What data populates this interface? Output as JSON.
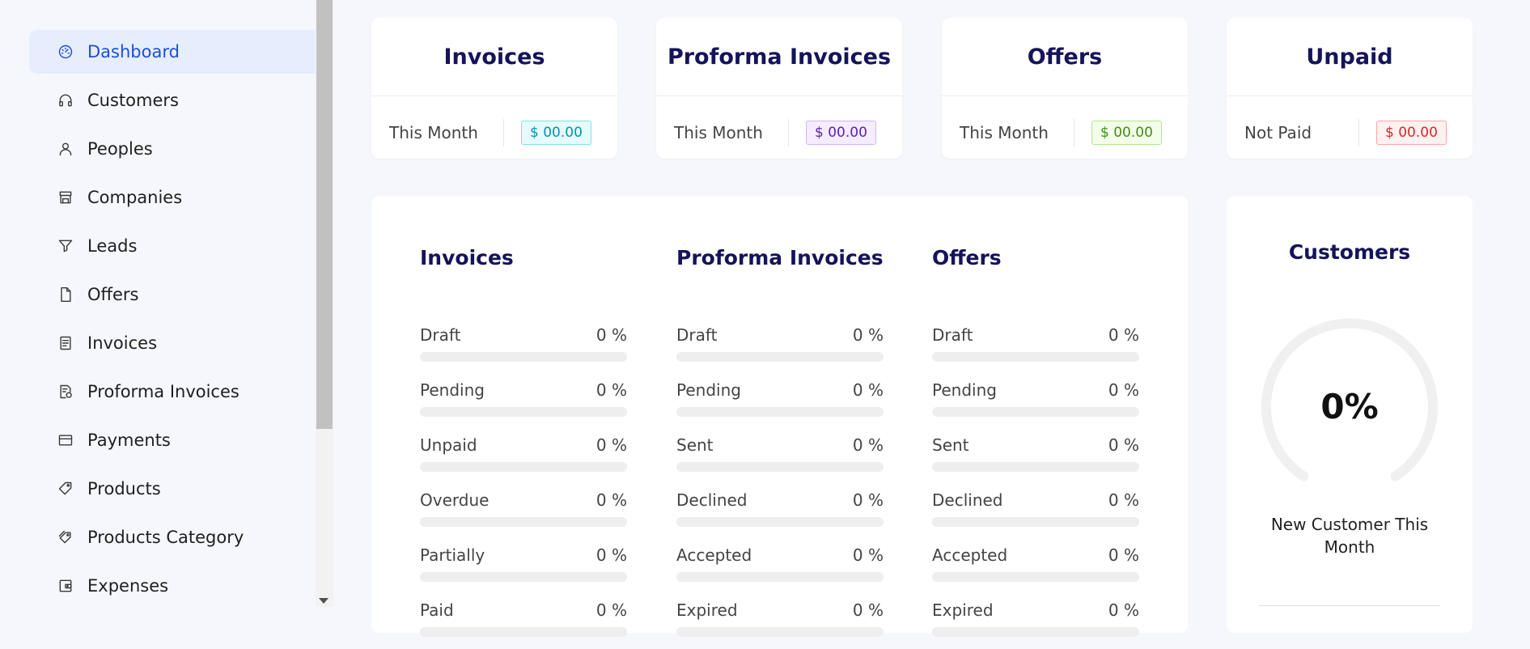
{
  "sidebar": {
    "items": [
      {
        "label": "Dashboard",
        "icon": "dashboard-icon",
        "active": true
      },
      {
        "label": "Customers",
        "icon": "headset-icon"
      },
      {
        "label": "Peoples",
        "icon": "user-icon"
      },
      {
        "label": "Companies",
        "icon": "shop-icon"
      },
      {
        "label": "Leads",
        "icon": "filter-icon"
      },
      {
        "label": "Offers",
        "icon": "file-icon"
      },
      {
        "label": "Invoices",
        "icon": "container-icon"
      },
      {
        "label": "Proforma Invoices",
        "icon": "file-sync-icon"
      },
      {
        "label": "Payments",
        "icon": "credit-card-icon"
      },
      {
        "label": "Products",
        "icon": "tag-icon"
      },
      {
        "label": "Products Category",
        "icon": "tags-icon"
      },
      {
        "label": "Expenses",
        "icon": "wallet-icon"
      }
    ]
  },
  "stats": [
    {
      "title": "Invoices",
      "sub": "This Month",
      "value": "$ 00.00",
      "color": "cyan"
    },
    {
      "title": "Proforma Invoices",
      "sub": "This Month",
      "value": "$ 00.00",
      "color": "purple"
    },
    {
      "title": "Offers",
      "sub": "This Month",
      "value": "$ 00.00",
      "color": "green"
    },
    {
      "title": "Unpaid",
      "sub": "Not Paid",
      "value": "$ 00.00",
      "color": "red"
    }
  ],
  "panel": {
    "columns": [
      {
        "title": "Invoices",
        "rows": [
          {
            "label": "Draft",
            "value": "0 %",
            "percent": 0
          },
          {
            "label": "Pending",
            "value": "0 %",
            "percent": 0
          },
          {
            "label": "Unpaid",
            "value": "0 %",
            "percent": 0
          },
          {
            "label": "Overdue",
            "value": "0 %",
            "percent": 0
          },
          {
            "label": "Partially",
            "value": "0 %",
            "percent": 0
          },
          {
            "label": "Paid",
            "value": "0 %",
            "percent": 0
          }
        ]
      },
      {
        "title": "Proforma Invoices",
        "rows": [
          {
            "label": "Draft",
            "value": "0 %",
            "percent": 0
          },
          {
            "label": "Pending",
            "value": "0 %",
            "percent": 0
          },
          {
            "label": "Sent",
            "value": "0 %",
            "percent": 0
          },
          {
            "label": "Declined",
            "value": "0 %",
            "percent": 0
          },
          {
            "label": "Accepted",
            "value": "0 %",
            "percent": 0
          },
          {
            "label": "Expired",
            "value": "0 %",
            "percent": 0
          }
        ]
      },
      {
        "title": "Offers",
        "rows": [
          {
            "label": "Draft",
            "value": "0 %",
            "percent": 0
          },
          {
            "label": "Pending",
            "value": "0 %",
            "percent": 0
          },
          {
            "label": "Sent",
            "value": "0 %",
            "percent": 0
          },
          {
            "label": "Declined",
            "value": "0 %",
            "percent": 0
          },
          {
            "label": "Accepted",
            "value": "0 %",
            "percent": 0
          },
          {
            "label": "Expired",
            "value": "0 %",
            "percent": 0
          }
        ]
      }
    ]
  },
  "customers": {
    "title": "Customers",
    "percent": "0%",
    "caption": "New Customer This Month"
  },
  "colors": {
    "accent": "#1d4ed8",
    "heading": "#15135a",
    "active_bg": "#e6edfd"
  }
}
